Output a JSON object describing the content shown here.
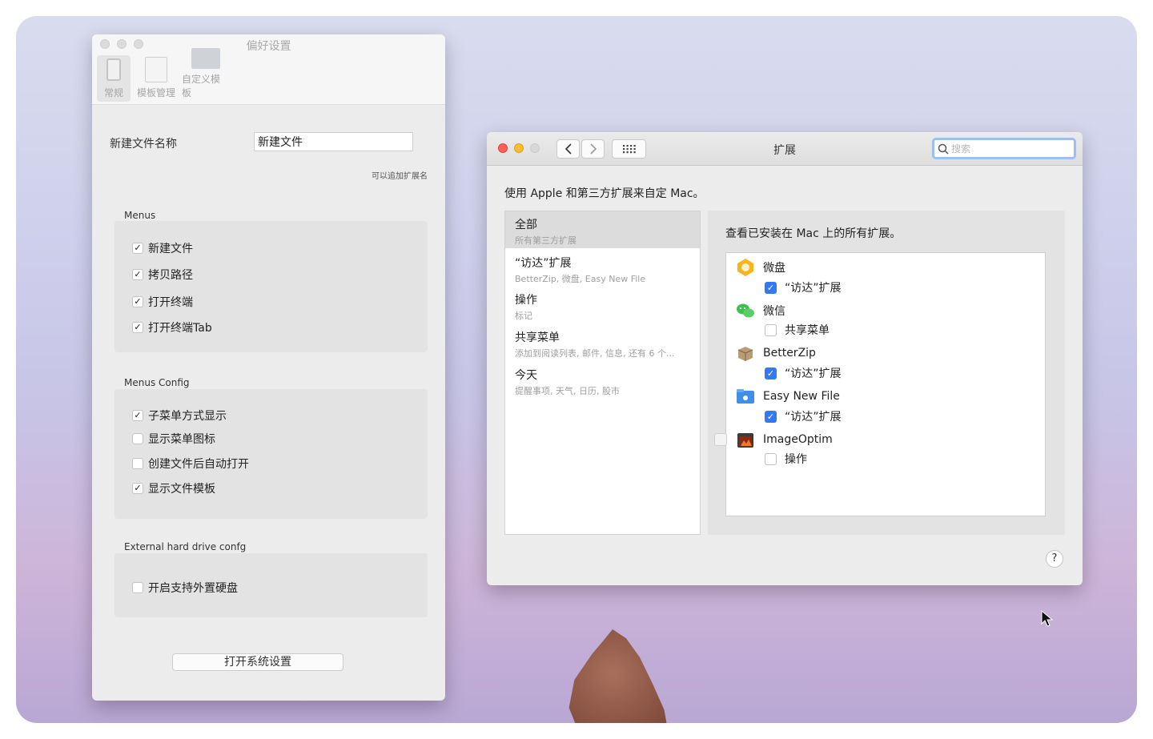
{
  "prefs": {
    "title": "偏好设置",
    "tabs": [
      {
        "label": "常规"
      },
      {
        "label": "模板管理"
      },
      {
        "label": "自定义模板"
      }
    ],
    "new_file_name_label": "新建文件名称",
    "new_file_name_value": "新建文件",
    "ext_hint": "可以追加扩展名",
    "menus": {
      "label": "Menus",
      "items": [
        {
          "label": "新建文件",
          "checked": "✓"
        },
        {
          "label": "拷贝路径",
          "checked": "✓"
        },
        {
          "label": "打开终端",
          "checked": "✓"
        },
        {
          "label": "打开终端Tab",
          "checked": "✓"
        }
      ]
    },
    "menus_config": {
      "label": "Menus Config",
      "items": [
        {
          "label": "子菜单方式显示",
          "checked": "✓"
        },
        {
          "label": "显示菜单图标",
          "checked": ""
        },
        {
          "label": "创建文件后自动打开",
          "checked": ""
        },
        {
          "label": "显示文件模板",
          "checked": "✓"
        }
      ]
    },
    "external": {
      "label": "External hard drive confg",
      "items": [
        {
          "label": "开启支持外置硬盘",
          "checked": ""
        }
      ]
    },
    "open_system_settings": "打开系统设置"
  },
  "extensions": {
    "title": "扩展",
    "search_placeholder": "搜索",
    "description": "使用 Apple 和第三方扩展来自定 Mac。",
    "categories": [
      {
        "name": "全部",
        "sub": "所有第三方扩展"
      },
      {
        "name": "“访达”扩展",
        "sub": "BetterZip, 微盘, Easy New File"
      },
      {
        "name": "操作",
        "sub": "标记"
      },
      {
        "name": "共享菜单",
        "sub": "添加到阅读列表, 邮件, 信息, 还有 6 个..."
      },
      {
        "name": "今天",
        "sub": "提醒事项, 天气, 日历, 股市"
      }
    ],
    "right_description": "查看已安装在 Mac 上的所有扩展。",
    "apps": [
      {
        "name": "微盘",
        "ext": "“访达”扩展",
        "enabled": true,
        "icon": "weipan-icon",
        "color": "#f5b521"
      },
      {
        "name": "微信",
        "ext": "共享菜单",
        "enabled": false,
        "icon": "wechat-icon",
        "color": "#3fbf4f"
      },
      {
        "name": "BetterZip",
        "ext": "“访达”扩展",
        "enabled": true,
        "icon": "betterzip-icon",
        "color": "#a9906c"
      },
      {
        "name": "Easy New File",
        "ext": "“访达”扩展",
        "enabled": true,
        "icon": "easynewfile-icon",
        "color": "#3f8ee8"
      },
      {
        "name": "ImageOptim",
        "ext": "操作",
        "enabled": false,
        "icon": "imageoptim-icon",
        "color": "#3a3a3a"
      }
    ],
    "help_label": "?"
  }
}
